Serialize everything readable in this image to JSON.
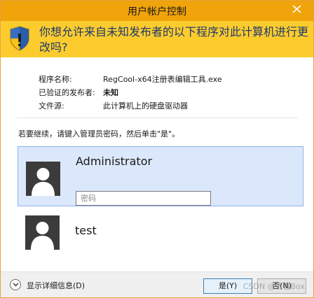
{
  "window": {
    "title": "用户帐户控制",
    "question": "你想允许来自未知发布者的以下程序对此计算机进行更改吗?"
  },
  "program_info": {
    "name_label": "程序名称:",
    "name_value": "RegCool-x64注册表编辑工具.exe",
    "publisher_label": "已验证的发布者:",
    "publisher_value": "未知",
    "source_label": "文件源:",
    "source_value": "此计算机上的硬盘驱动器"
  },
  "instruction": "若要继续，请键入管理员密码，然后单击\"是\"。",
  "users": [
    {
      "name": "Administrator",
      "password_placeholder": "密码",
      "selected": true
    },
    {
      "name": "test",
      "selected": false
    }
  ],
  "footer": {
    "details_label": "显示详细信息(D)",
    "yes_label": "是(Y)",
    "no_label": "否(N)",
    "watermark": "CSDN @青春Box"
  },
  "colors": {
    "title_bar": "#f0a30a",
    "header_band": "#fccc2e",
    "selected_tile": "#dbe8fb",
    "question_text": "#1e3a6e"
  },
  "icons": {
    "window_close": "close-icon",
    "shield": "uac-shield-icon",
    "user_avatar": "user-avatar-icon",
    "details": "chevron-down-icon"
  }
}
